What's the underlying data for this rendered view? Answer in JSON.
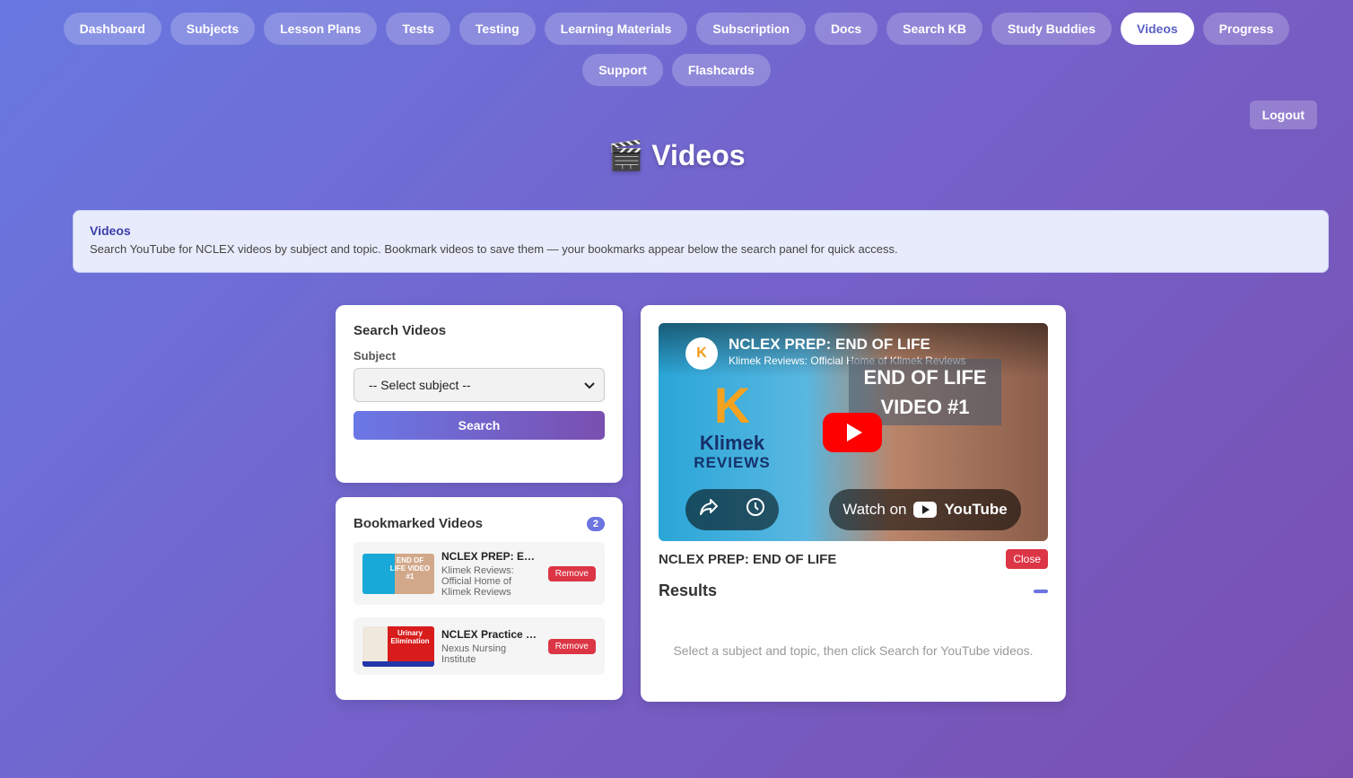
{
  "nav": {
    "items": [
      {
        "label": "Dashboard",
        "active": false
      },
      {
        "label": "Subjects",
        "active": false
      },
      {
        "label": "Lesson Plans",
        "active": false
      },
      {
        "label": "Tests",
        "active": false
      },
      {
        "label": "Testing",
        "active": false
      },
      {
        "label": "Learning Materials",
        "active": false
      },
      {
        "label": "Subscription",
        "active": false
      },
      {
        "label": "Docs",
        "active": false
      },
      {
        "label": "Search KB",
        "active": false
      },
      {
        "label": "Study Buddies",
        "active": false
      },
      {
        "label": "Videos",
        "active": true
      },
      {
        "label": "Progress",
        "active": false
      },
      {
        "label": "Support",
        "active": false
      },
      {
        "label": "Flashcards",
        "active": false
      }
    ]
  },
  "header": {
    "logout_label": "Logout",
    "page_icon": "🎬",
    "page_title": "Videos"
  },
  "info": {
    "title": "Videos",
    "text": "Search YouTube for NCLEX videos by subject and topic. Bookmark videos to save them — your bookmarks appear below the search panel for quick access."
  },
  "search": {
    "heading": "Search Videos",
    "subject_label": "Subject",
    "subject_selected": "-- Select subject --",
    "search_button": "Search"
  },
  "bookmarks": {
    "heading": "Bookmarked Videos",
    "count": "2",
    "items": [
      {
        "title": "NCLEX PREP: END OF LIFE",
        "channel": "Klimek Reviews: Official Home of Klimek Reviews",
        "thumb_text": "END OF LIFE VIDEO #1",
        "remove_label": "Remove"
      },
      {
        "title": "NCLEX Practice for Urinary Elimination",
        "channel": "Nexus Nursing Institute",
        "thumb_text": "Urinary Elimination",
        "remove_label": "Remove"
      }
    ]
  },
  "player": {
    "video_title": "NCLEX PREP: END OF LIFE",
    "video_channel": "Klimek Reviews: Official Home of Klimek Reviews",
    "overlay_line1": "END OF LIFE",
    "overlay_line2": "VIDEO #1",
    "brand_letter": "K",
    "brand_name": "Klimek",
    "brand_sub": "REVIEWS",
    "watch_on": "Watch on",
    "youtube_label": "YouTube",
    "now_playing_title": "NCLEX PREP: END OF LIFE",
    "close_label": "Close"
  },
  "results": {
    "heading": "Results",
    "empty_message": "Select a subject and topic, then click Search for YouTube videos."
  },
  "colors": {
    "accent": "#6c74e0",
    "danger": "#dc3545",
    "active_text": "#5b5fc7"
  }
}
